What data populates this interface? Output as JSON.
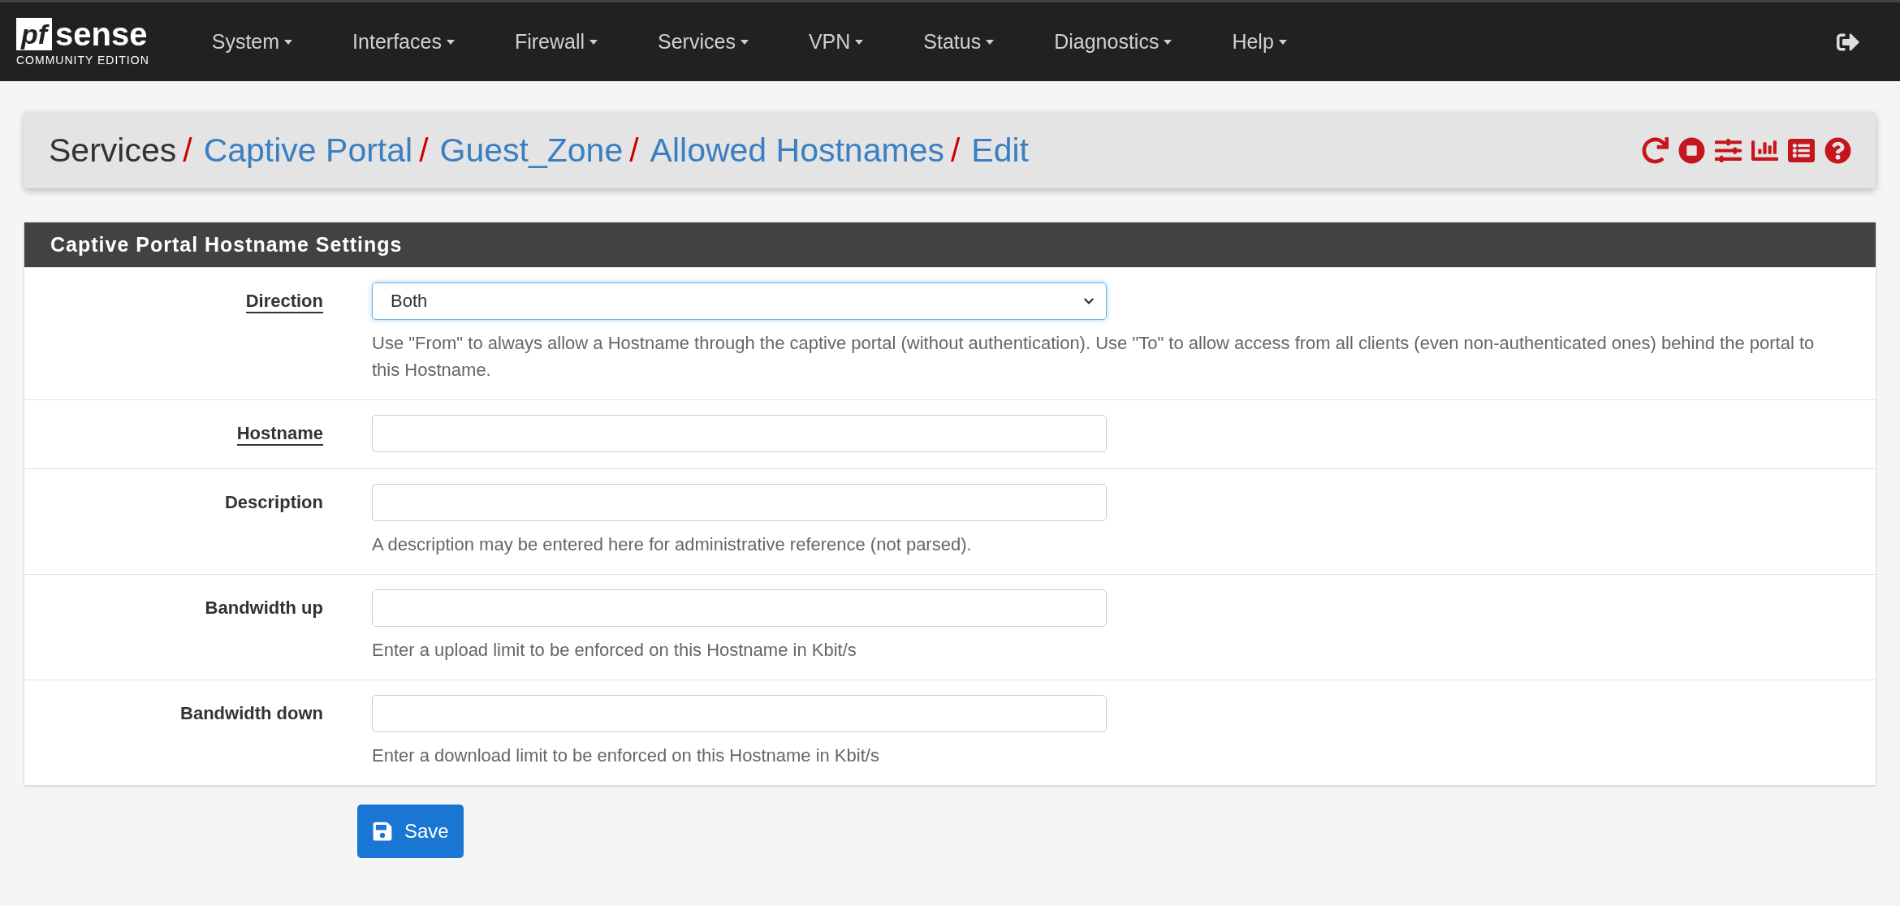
{
  "brand": {
    "mark": "pf",
    "name": "sense",
    "edition": "COMMUNITY EDITION"
  },
  "nav": [
    {
      "label": "System"
    },
    {
      "label": "Interfaces"
    },
    {
      "label": "Firewall"
    },
    {
      "label": "Services"
    },
    {
      "label": "VPN"
    },
    {
      "label": "Status"
    },
    {
      "label": "Diagnostics"
    },
    {
      "label": "Help"
    }
  ],
  "breadcrumb_separator": "/",
  "breadcrumb": [
    {
      "label": "Services",
      "link": false
    },
    {
      "label": "Captive Portal",
      "link": true
    },
    {
      "label": "Guest_Zone",
      "link": true
    },
    {
      "label": "Allowed Hostnames",
      "link": true
    },
    {
      "label": "Edit",
      "link": true
    }
  ],
  "panel": {
    "title": "Captive Portal Hostname Settings"
  },
  "fields": [
    {
      "label": "Direction",
      "required": true,
      "kind": "select",
      "value": "Both",
      "focused": true,
      "help": "Use \"From\" to always allow a Hostname through the captive portal (without authentication). Use \"To\" to allow access from all clients (even non-authenticated ones) behind the portal to this Hostname."
    },
    {
      "label": "Hostname",
      "required": true,
      "kind": "text",
      "focused": false
    },
    {
      "label": "Description",
      "required": false,
      "kind": "text",
      "focused": false,
      "help": "A description may be entered here for administrative reference (not parsed)."
    },
    {
      "label": "Bandwidth up",
      "required": false,
      "kind": "text",
      "focused": false,
      "help": "Enter a upload limit to be enforced on this Hostname in Kbit/s"
    },
    {
      "label": "Bandwidth down",
      "required": false,
      "kind": "text",
      "focused": false,
      "help": "Enter a download limit to be enforced on this Hostname in Kbit/s"
    }
  ],
  "save_button": {
    "label": "Save"
  }
}
